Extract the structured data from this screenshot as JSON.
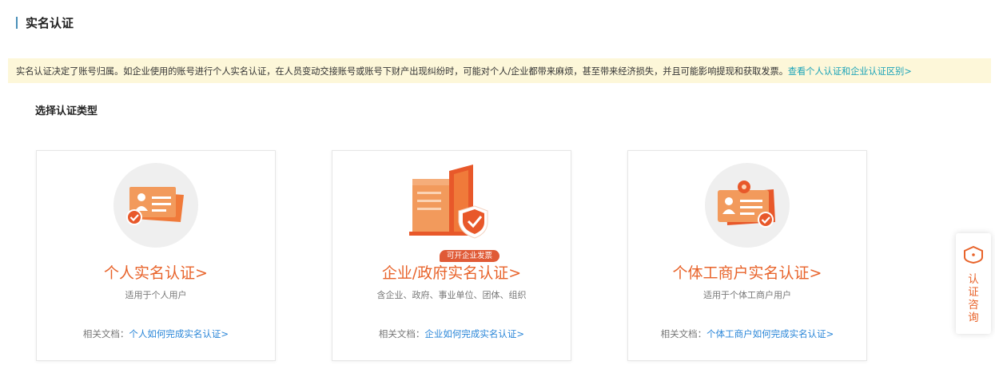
{
  "header": {
    "title": "实名认证"
  },
  "notice": {
    "text": "实名认证决定了账号归属。如企业使用的账号进行个人实名认证，在人员变动交接账号或账号下财产出现纠纷时，可能对个人/企业都带来麻烦，甚至带来经济损失，并且可能影响提现和获取发票。",
    "link": "查看个人认证和企业认证区别>"
  },
  "section": {
    "title": "选择认证类型"
  },
  "cards": [
    {
      "icon": "personal-id-card-icon",
      "title": "个人实名认证>",
      "desc": "适用于个人用户",
      "doc_label": "相关文档：",
      "doc_link": "个人如何完成实名认证>"
    },
    {
      "icon": "enterprise-building-icon",
      "badge": "可开企业发票",
      "title": "企业/政府实名认证>",
      "desc": "含企业、政府、事业单位、团体、组织",
      "doc_label": "相关文档：",
      "doc_link": "企业如何完成实名认证>"
    },
    {
      "icon": "business-license-icon",
      "title": "个体工商户实名认证>",
      "desc": "适用于个体工商户用户",
      "doc_label": "相关文档：",
      "doc_link": "个体工商户如何完成实名认证>"
    }
  ],
  "float_button": {
    "icon": "consult-shield-icon",
    "label": "认证咨询"
  },
  "colors": {
    "accent": "#e8632a",
    "link": "#2a86d8",
    "notice_bg": "#fdf7d9",
    "notice_link": "#1aa3b8"
  }
}
